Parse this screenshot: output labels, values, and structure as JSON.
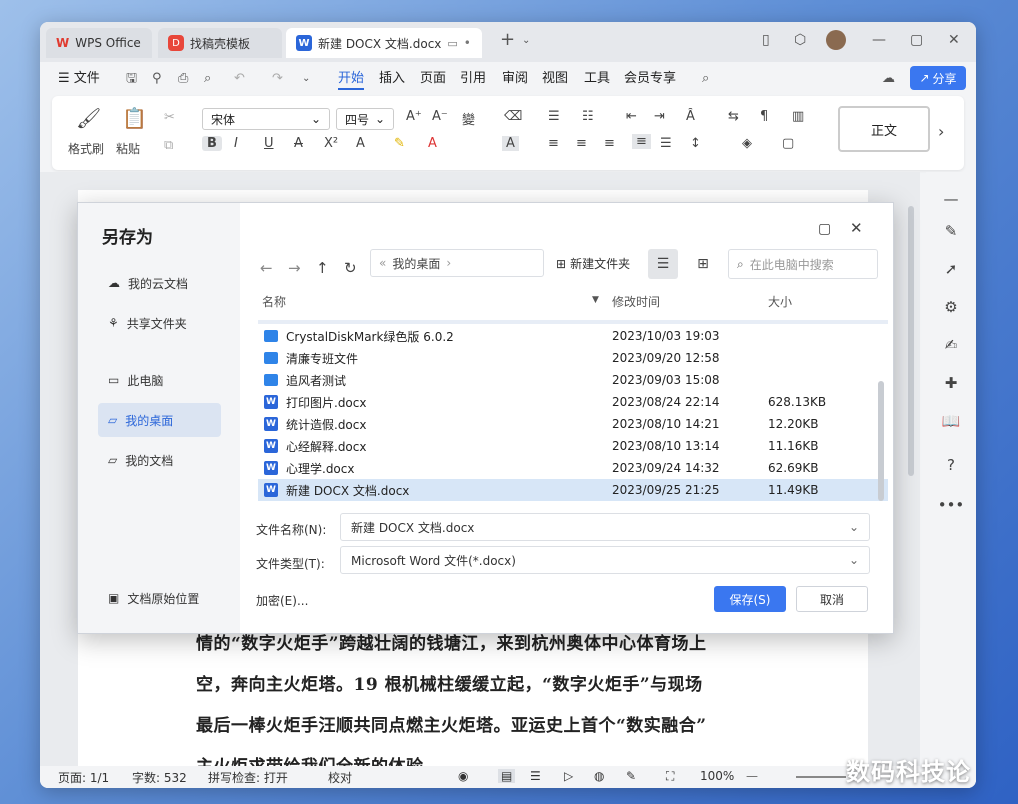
{
  "tabs": {
    "wps": "WPS Office",
    "template": "找稿壳模板",
    "doc": "新建 DOCX 文档.docx"
  },
  "menu": {
    "file": "文件",
    "items": [
      "开始",
      "插入",
      "页面",
      "引用",
      "审阅",
      "视图",
      "工具",
      "会员专享"
    ],
    "share": "分享"
  },
  "ribbon": {
    "format_painter": "格式刷",
    "paste": "粘贴",
    "font": "宋体",
    "size": "四号",
    "style": "正文"
  },
  "doc": {
    "lines": [
      "情的“数字火炬手”跨越壮阔的钱塘江，来到杭州奥体中心体育场上",
      "空，奔向主火炬塔。19 根机械柱缓缓立起，“数字火炬手”与现场",
      "最后一棒火炬手汪顺共同点燃主火炬塔。亚运史上首个“数实融合”",
      "主火炬求带给我们全新的体验"
    ]
  },
  "status": {
    "page": "页面: 1/1",
    "words": "字数: 532",
    "spell": "拼写检查: 打开",
    "proof": "校对",
    "zoom": "100%"
  },
  "dialog": {
    "title": "另存为",
    "sidebar": [
      "我的云文档",
      "共享文件夹",
      "此电脑",
      "我的桌面",
      "我的文档"
    ],
    "sidebar_bottom": "文档原始位置",
    "breadcrumb": "我的桌面",
    "new_folder": "新建文件夹",
    "search_placeholder": "在此电脑中搜索",
    "headers": {
      "name": "名称",
      "modified": "修改时间",
      "size": "大小"
    },
    "files": [
      {
        "name": "CrystalDiskMark绿色版 6.0.2",
        "date": "2023/10/03 19:03",
        "size": "",
        "type": "folder"
      },
      {
        "name": "清廉专班文件",
        "date": "2023/09/20 12:58",
        "size": "",
        "type": "folder"
      },
      {
        "name": "追风者测试",
        "date": "2023/09/03 15:08",
        "size": "",
        "type": "folder"
      },
      {
        "name": "打印图片.docx",
        "date": "2023/08/24 22:14",
        "size": "628.13KB",
        "type": "docx"
      },
      {
        "name": "统计造假.docx",
        "date": "2023/08/10 14:21",
        "size": "12.20KB",
        "type": "docx"
      },
      {
        "name": "心经解释.docx",
        "date": "2023/08/10 13:14",
        "size": "11.16KB",
        "type": "docx"
      },
      {
        "name": "心理学.docx",
        "date": "2023/09/24 14:32",
        "size": "62.69KB",
        "type": "docx"
      },
      {
        "name": "新建 DOCX 文档.docx",
        "date": "2023/09/25 21:25",
        "size": "11.49KB",
        "type": "docx"
      }
    ],
    "filename_label": "文件名称(N):",
    "filename": "新建 DOCX 文档.docx",
    "filetype_label": "文件类型(T):",
    "filetype": "Microsoft Word 文件(*.docx)",
    "encrypt": "加密(E)...",
    "save": "保存(S)",
    "cancel": "取消"
  },
  "watermark": "数码科技论"
}
